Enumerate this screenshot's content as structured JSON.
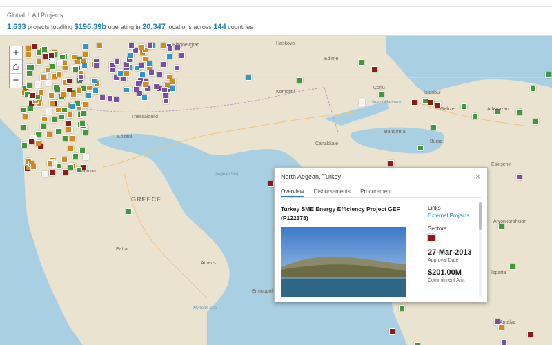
{
  "breadcrumb": {
    "global": "Global",
    "separator": "/",
    "current": "All Projects"
  },
  "summary": {
    "count": "1,633",
    "text1": "projects totalling",
    "total": "$196.39b",
    "text2": "operating in",
    "locations": "20,347",
    "text3": "locations across",
    "countries": "144",
    "text4": "countries"
  },
  "zoom": {
    "in": "+",
    "home_icon": "home-icon",
    "out": "−"
  },
  "map_labels": {
    "greece": "GREECE",
    "athens": "Athens",
    "thessaloniki": "Thessaloniki",
    "komotini": "Komotini",
    "edirne": "Edirne",
    "haskovo": "Haskovo",
    "blagoevgrad": "Blagoevgrad",
    "istanbul": "İstanbul",
    "gebze": "Gebze",
    "adapazari": "Adapazarı",
    "bursa": "Bursa",
    "bandirma": "Bandırma",
    "canakkale": "Çanakkale",
    "eskisehir": "Eskişehir",
    "ioannina": "Ioannina",
    "patra": "Patra",
    "kozani": "Kozani",
    "corlu": "Çorlu",
    "aegean_sea": "Aegean Sea",
    "marmara": "Sea of Marmara",
    "cretan": "Myrtoan Sea",
    "ermoupoli": "Ermoupoli",
    "isparta": "Isparta",
    "afyon": "Afyonkarahisar",
    "antalya": "Antalya"
  },
  "popup": {
    "title": "North Aegean, Turkey",
    "close": "×",
    "tabs": [
      "Overview",
      "Disbursements",
      "Procurement"
    ],
    "project_title": "Turkey SME Energy Efficiency Project GEF (P122178)",
    "links_label": "Links",
    "links_value": "External Projects",
    "sectors_label": "Sectors",
    "date": "27-Mar-2013",
    "date_label": "Approval Date",
    "amount": "$201.00M",
    "amount_label": "Commitment Amt"
  },
  "colors": {
    "green": "#3f9a3a",
    "orange": "#d9891b",
    "purple": "#7b4ea8",
    "blue": "#2a98c9",
    "darkred": "#8b1c1c",
    "white_marker": "#f2f2f2",
    "sea": "#a9cfe2",
    "land": "#eae3d0",
    "accent": "#1a7fc1"
  }
}
